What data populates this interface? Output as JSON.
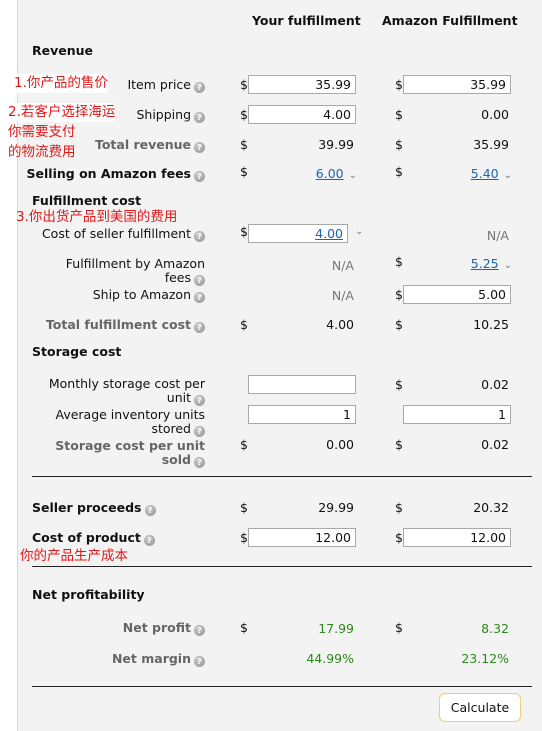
{
  "columns": {
    "yours": "Your fulfillment",
    "amazon": "Amazon Fulfillment"
  },
  "sections": {
    "revenue": "Revenue",
    "fulfillment": "Fulfillment cost",
    "storage": "Storage cost",
    "net": "Net profitability"
  },
  "rows": {
    "item_price": {
      "label": "Item price",
      "yours": "35.99",
      "amazon": "35.99"
    },
    "shipping": {
      "label": "Shipping",
      "yours": "4.00",
      "amazon": "0.00"
    },
    "total_revenue": {
      "label": "Total revenue",
      "yours": "39.99",
      "amazon": "35.99"
    },
    "selling_fees": {
      "label": "Selling on Amazon fees",
      "yours": "6.00",
      "amazon": "5.40"
    },
    "seller_fulfillment": {
      "label": "Cost of seller fulfillment",
      "yours": "4.00",
      "amazon": "N/A"
    },
    "fba_fees": {
      "label": "Fulfillment by Amazon fees",
      "yours": "N/A",
      "amazon": "5.25"
    },
    "ship_to_amazon": {
      "label": "Ship to Amazon",
      "yours": "N/A",
      "amazon": "5.00"
    },
    "total_fulfillment": {
      "label": "Total fulfillment cost",
      "yours": "4.00",
      "amazon": "10.25"
    },
    "monthly_storage": {
      "label": "Monthly storage cost per unit",
      "yours": "",
      "amazon": "0.02"
    },
    "avg_inventory": {
      "label": "Average inventory units stored",
      "yours": "1",
      "amazon": "1"
    },
    "storage_per_unit": {
      "label": "Storage cost per unit sold",
      "yours": "0.00",
      "amazon": "0.02"
    },
    "seller_proceeds": {
      "label": "Seller proceeds",
      "yours": "29.99",
      "amazon": "20.32"
    },
    "cost_of_product": {
      "label": "Cost of product",
      "yours": "12.00",
      "amazon": "12.00"
    },
    "net_profit": {
      "label": "Net profit",
      "yours": "17.99",
      "amazon": "8.32"
    },
    "net_margin": {
      "label": "Net margin",
      "yours": "44.99%",
      "amazon": "23.12%"
    }
  },
  "currency": "$",
  "help_glyph": "?",
  "caret_glyph": "⌄",
  "calculate_label": "Calculate",
  "annotations": {
    "a1": "1.你产品的售价",
    "a2_line1": "2.若客户选择海运",
    "a2_line2": "你需要支付",
    "a2_line3": "的物流费用",
    "a3": "3.你出货产品到美国的费用",
    "a4": "你的产品生产成本"
  },
  "colors": {
    "link": "#1a65b0",
    "profit_green": "#2a8a19",
    "annotation_red": "#e01818",
    "button_border": "#f0d070"
  }
}
